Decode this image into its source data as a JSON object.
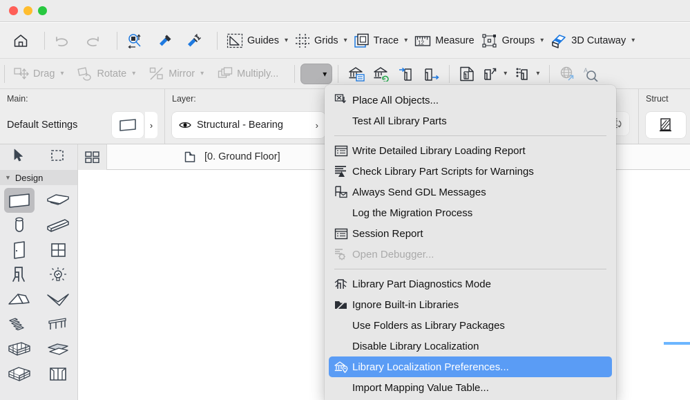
{
  "window": {
    "traffic_lights": [
      "close",
      "minimize",
      "zoom"
    ],
    "accent_blue": "#5a9cf5",
    "chrome_bg": "#efefef"
  },
  "toolbar_row1": {
    "items": [
      {
        "name": "home-icon",
        "label": "",
        "icon": "home",
        "dim": false,
        "chevron": false
      },
      {
        "name": "undo-icon",
        "label": "",
        "icon": "undo",
        "dim": true,
        "chevron": false
      },
      {
        "name": "redo-icon",
        "label": "",
        "icon": "redo",
        "dim": true,
        "chevron": false
      },
      {
        "name": "marquee-zoom-icon",
        "label": "",
        "icon": "marquee-zoom",
        "dim": false,
        "chevron": false
      },
      {
        "name": "pick-up-parameters-icon",
        "label": "",
        "icon": "eyedropper",
        "dim": false,
        "chevron": false
      },
      {
        "name": "inject-parameters-icon",
        "label": "",
        "icon": "syringe",
        "dim": false,
        "chevron": false
      },
      {
        "name": "guides-button",
        "label": "Guides",
        "icon": "guides",
        "dim": false,
        "chevron": true
      },
      {
        "name": "grids-button",
        "label": "Grids",
        "icon": "grids",
        "dim": false,
        "chevron": true
      },
      {
        "name": "trace-button",
        "label": "Trace",
        "icon": "trace",
        "dim": false,
        "chevron": true
      },
      {
        "name": "measure-button",
        "label": "Measure",
        "icon": "ruler",
        "dim": false,
        "chevron": false
      },
      {
        "name": "groups-button",
        "label": "Groups",
        "icon": "groups",
        "dim": false,
        "chevron": true
      },
      {
        "name": "cutaway-3d-button",
        "label": "3D Cutaway",
        "icon": "cutaway",
        "dim": false,
        "chevron": true
      }
    ]
  },
  "toolbar_row2": {
    "items": [
      {
        "name": "drag-button",
        "label": "Drag",
        "icon": "drag",
        "dim": true,
        "chevron": true
      },
      {
        "name": "rotate-button",
        "label": "Rotate",
        "icon": "rotate",
        "dim": true,
        "chevron": true
      },
      {
        "name": "mirror-button",
        "label": "Mirror",
        "icon": "mirror",
        "dim": true,
        "chevron": true
      },
      {
        "name": "multiply-button",
        "label": "Multiply...",
        "icon": "multiply",
        "dim": true,
        "chevron": false
      }
    ],
    "active_dropdown": {
      "name": "library-manager-dropdown",
      "chevron": "▾"
    },
    "icon_buttons": [
      {
        "name": "library-manager-icon",
        "icon": "library-list"
      },
      {
        "name": "reload-libraries-icon",
        "icon": "library-refresh"
      },
      {
        "name": "import-library-part-icon",
        "icon": "part-in"
      },
      {
        "name": "export-library-part-icon",
        "icon": "part-out"
      },
      {
        "name": "open-object-icon",
        "icon": "part-doc"
      },
      {
        "name": "place-object-icon",
        "icon": "part-up",
        "chevron": true
      },
      {
        "name": "object-settings-icon",
        "icon": "part-settings",
        "chevron": true
      },
      {
        "name": "bimcloud-icon",
        "icon": "globe",
        "dim": true
      },
      {
        "name": "find-library-part-icon",
        "icon": "search-a"
      }
    ]
  },
  "infobar": {
    "sections": [
      {
        "name": "main-settings",
        "label": "Main:",
        "value": "Default Settings",
        "button_icon": "wall-tool",
        "arrow": "›"
      },
      {
        "name": "layer-settings",
        "label": "Layer:",
        "value": "Structural - Bearing",
        "icon": "eye-icon",
        "arrow": "›"
      },
      {
        "name": "structure-settings",
        "label": "Struct",
        "value": "",
        "icon": "wall-section-icon"
      }
    ],
    "reference_button": {
      "name": "reference-line-button",
      "icon": "reference-line"
    }
  },
  "tabstrip": {
    "arrow_tool": "arrow-tool",
    "marquee_tool": "marquee-tool",
    "grid_view": "tile-view-icon",
    "story_icon": "story-icon",
    "story_label": "[0. Ground Floor]"
  },
  "toolbox": {
    "header": "Design",
    "collapse_glyph": "▼",
    "tools": [
      {
        "name": "tool-wall",
        "icon": "wall",
        "selected": true
      },
      {
        "name": "tool-slab",
        "icon": "slab",
        "selected": false
      },
      {
        "name": "tool-column",
        "icon": "column",
        "selected": false
      },
      {
        "name": "tool-beam",
        "icon": "beam",
        "selected": false
      },
      {
        "name": "tool-door",
        "icon": "door",
        "selected": false
      },
      {
        "name": "tool-window",
        "icon": "window",
        "selected": false
      },
      {
        "name": "tool-object",
        "icon": "object-chair",
        "selected": false
      },
      {
        "name": "tool-lamp",
        "icon": "lamp",
        "selected": false
      },
      {
        "name": "tool-roof",
        "icon": "roof",
        "selected": false
      },
      {
        "name": "tool-shell",
        "icon": "shell",
        "selected": false
      },
      {
        "name": "tool-stair",
        "icon": "stair",
        "selected": false
      },
      {
        "name": "tool-railing",
        "icon": "railing",
        "selected": false
      },
      {
        "name": "tool-curtain-wall",
        "icon": "curtain-wall",
        "selected": false
      },
      {
        "name": "tool-morph",
        "icon": "morph",
        "selected": false
      },
      {
        "name": "tool-mesh",
        "icon": "mesh",
        "selected": false
      },
      {
        "name": "tool-zone",
        "icon": "zone",
        "selected": false
      }
    ]
  },
  "menu": {
    "name": "library-developer-menu",
    "groups": [
      {
        "items": [
          {
            "name": "menu-place-all-objects",
            "label": "Place All Objects...",
            "icon": "place-objects",
            "state": "normal"
          },
          {
            "name": "menu-test-all-library-parts",
            "label": "Test All Library Parts",
            "icon": "",
            "state": "normal"
          }
        ]
      },
      {
        "items": [
          {
            "name": "menu-write-detailed-library-loading-report",
            "label": "Write Detailed Library Loading Report",
            "icon": "report-grid",
            "state": "normal"
          },
          {
            "name": "menu-check-library-part-scripts-for-warnings",
            "label": "Check Library Part Scripts for Warnings",
            "icon": "script-warn",
            "state": "normal"
          },
          {
            "name": "menu-always-send-gdl-messages",
            "label": "Always Send GDL Messages",
            "icon": "gdl-mail",
            "state": "normal"
          },
          {
            "name": "menu-log-the-migration-process",
            "label": "Log the Migration Process",
            "icon": "",
            "state": "normal"
          },
          {
            "name": "menu-session-report",
            "label": "Session Report",
            "icon": "report-grid",
            "state": "normal"
          },
          {
            "name": "menu-open-debugger",
            "label": "Open Debugger...",
            "icon": "debugger",
            "state": "disabled"
          }
        ]
      },
      {
        "items": [
          {
            "name": "menu-library-part-diagnostics-mode",
            "label": "Library Part Diagnostics Mode",
            "icon": "diagnostics",
            "state": "normal"
          },
          {
            "name": "menu-ignore-built-in-libraries",
            "label": "Ignore Built-in Libraries",
            "icon": "folder-slash",
            "state": "normal"
          },
          {
            "name": "menu-use-folders-as-library-packages",
            "label": "Use Folders as Library Packages",
            "icon": "",
            "state": "normal"
          },
          {
            "name": "menu-disable-library-localization",
            "label": "Disable Library Localization",
            "icon": "",
            "state": "normal"
          },
          {
            "name": "menu-library-localization-preferences",
            "label": "Library Localization Preferences...",
            "icon": "localization",
            "state": "selected"
          },
          {
            "name": "menu-import-mapping-value-table",
            "label": "Import Mapping Value Table...",
            "icon": "",
            "state": "normal"
          }
        ]
      }
    ]
  },
  "canvas": {
    "wall_element_color": "#6cb6ff"
  }
}
